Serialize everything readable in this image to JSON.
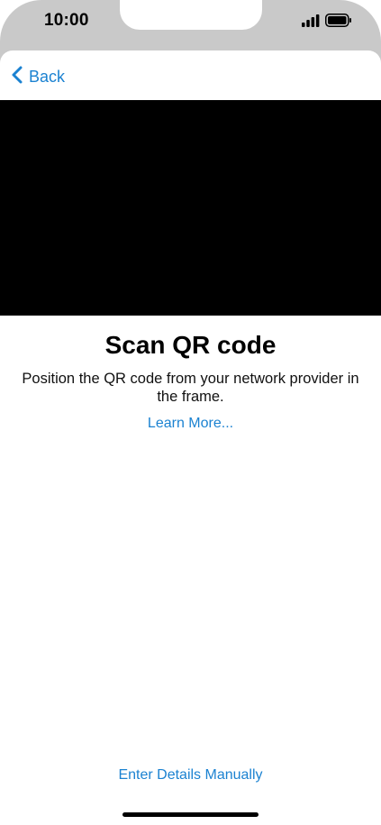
{
  "status_bar": {
    "time": "10:00",
    "icons": [
      "cellular-signal-icon",
      "battery-icon"
    ]
  },
  "nav": {
    "back_label": "Back",
    "back_icon": "chevron-left-icon"
  },
  "scanner": {
    "title": "Scan QR code",
    "instructions": "Position the QR code from your network provider in the frame.",
    "learn_more_label": "Learn More...",
    "manual_entry_label": "Enter Details Manually"
  },
  "colors": {
    "accent": "#1b82d1",
    "frame": "#c9c9c9",
    "viewfinder": "#000000"
  }
}
